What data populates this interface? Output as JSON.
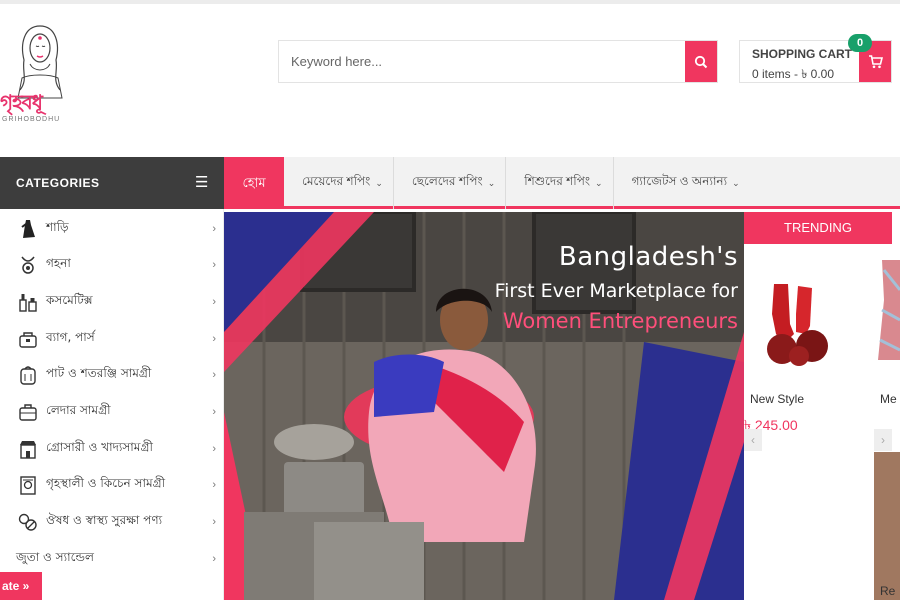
{
  "logo": {
    "name_bn": "গৃহবধূ",
    "name_en": "GRIHOBODHU"
  },
  "search": {
    "placeholder": "Keyword here..."
  },
  "cart": {
    "title": "SHOPPING CART",
    "summary": "0 items - ৳ 0.00",
    "badge_count": "0"
  },
  "categories_header": "CATEGORIES",
  "nav": {
    "home": "হোম",
    "items": [
      {
        "label": "মেয়েদের শপিং"
      },
      {
        "label": "ছেলেদের শপিং"
      },
      {
        "label": "শিশুদের শপিং"
      },
      {
        "label": "গ্যাজেটস ও অন্যান্য"
      }
    ]
  },
  "sidebar": {
    "items": [
      {
        "label": "শাড়ি",
        "icon": "saree-icon"
      },
      {
        "label": "গহনা",
        "icon": "jewelry-icon"
      },
      {
        "label": "কসমেটিক্স",
        "icon": "cosmetics-icon"
      },
      {
        "label": "ব্যাগ, পার্স",
        "icon": "bag-icon"
      },
      {
        "label": "পাট ও শতরঞ্জি সামগ্রী",
        "icon": "jute-icon"
      },
      {
        "label": "লেদার সামগ্রী",
        "icon": "leather-icon"
      },
      {
        "label": "গ্রোসারী ও খাদ্যসামগ্রী",
        "icon": "grocery-icon"
      },
      {
        "label": "গৃহস্থালী ও কিচেন সামগ্রী",
        "icon": "kitchen-icon"
      },
      {
        "label": "ঔষধ ও স্বাস্থ্য সুরক্ষা পণ্য",
        "icon": "health-icon"
      },
      {
        "label": "জুতা ও স্যান্ডেল",
        "icon": ""
      }
    ]
  },
  "rate_tab": "ate »",
  "hero": {
    "line1": "Bangladesh's",
    "line2": "First Ever Marketplace for",
    "line3": "Women Entrepreneurs"
  },
  "trending": {
    "title": "TRENDING",
    "products": [
      {
        "name": "New Style",
        "price": "৳ 245.00"
      },
      {
        "name": "Me"
      }
    ],
    "partial_text": "Re"
  },
  "colors": {
    "accent": "#f0365f",
    "dark": "#3d3d3d",
    "badge": "#18a06a"
  }
}
